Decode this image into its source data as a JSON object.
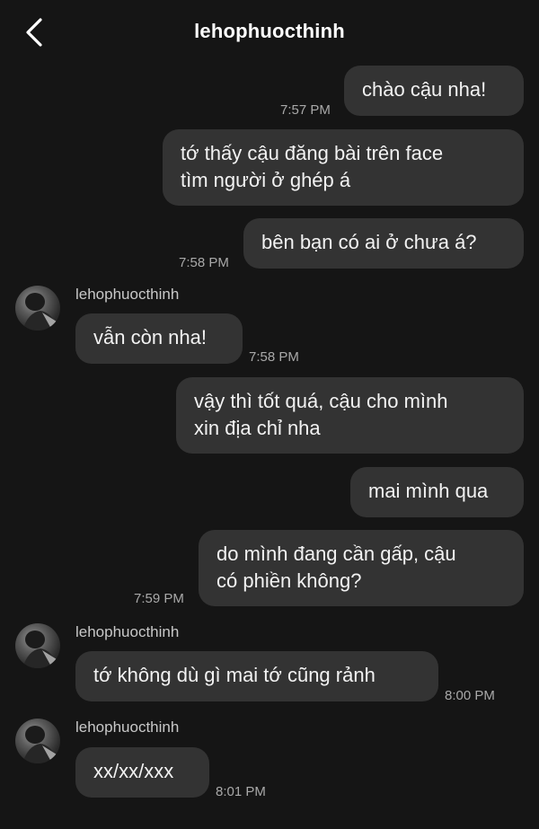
{
  "header": {
    "title": "lehophuocthinh",
    "back_icon": "chevron-left-icon"
  },
  "messages": [
    {
      "text": "chào cậu nha!",
      "time": "7:57 PM"
    },
    {
      "text": "tớ thấy cậu đăng bài trên face\ntìm người ở ghép á"
    },
    {
      "text": "bên bạn có ai ở chưa á?",
      "time": "7:58 PM"
    },
    {
      "sender": "lehophuocthinh",
      "text": "vẫn còn nha!",
      "time": "7:58 PM"
    },
    {
      "text": "vậy thì tốt quá, cậu cho mình\nxin địa chỉ nha"
    },
    {
      "text": "mai mình qua"
    },
    {
      "text": "do mình đang cần gấp, cậu\ncó phiền không?",
      "time": "7:59 PM"
    },
    {
      "sender": "lehophuocthinh",
      "text": "tớ không dù gì mai tớ cũng rảnh",
      "time": "8:00 PM"
    },
    {
      "sender": "lehophuocthinh",
      "text": "xx/xx/xxx",
      "time": "8:01 PM"
    }
  ],
  "colors": {
    "background": "#151515",
    "bubble": "#333333",
    "text": "#f2f2f2",
    "timestamp": "#a9a9a9"
  }
}
